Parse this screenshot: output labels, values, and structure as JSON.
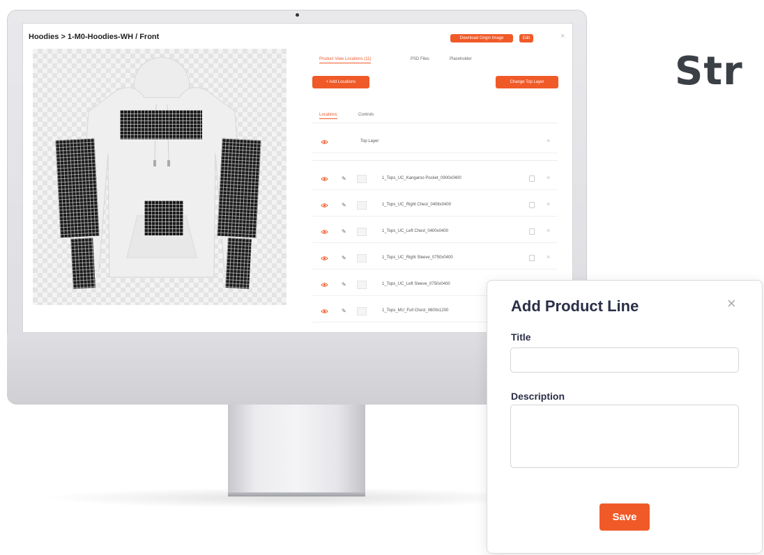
{
  "headline": "Str",
  "screen": {
    "breadcrumb": "Hoodies > 1-M0-Hoodies-WH / Front",
    "download_label": "Download Origin Image",
    "edit_label": "Edit",
    "close_icon": "×",
    "tabs": [
      "Product View Locations (11)",
      "PSD Files",
      "Placeholder"
    ],
    "add_locations_label": "+ Add Locations",
    "change_top_layer_label": "Change Top Layer",
    "subtabs": [
      "Locations",
      "Controls"
    ],
    "top_layer_label": "Top Layer",
    "layers": [
      "1_Tops_UC_Kangaroo Pocket_0900x0400",
      "1_Tops_UC_Right Chest_0406x0400",
      "1_Tops_UC_Left Chest_0400x0400",
      "1_Tops_UC_Right Sleeve_0750x0400",
      "1_Tops_UC_Left Sleeve_0750x0400",
      "1_Tops_MU_Full Chest_0600x1200"
    ],
    "accent_color": "#f05a28"
  },
  "modal": {
    "title": "Add Product Line",
    "close_icon": "×",
    "title_label": "Title",
    "title_value": "",
    "description_label": "Description",
    "description_value": "",
    "save_label": "Save"
  }
}
